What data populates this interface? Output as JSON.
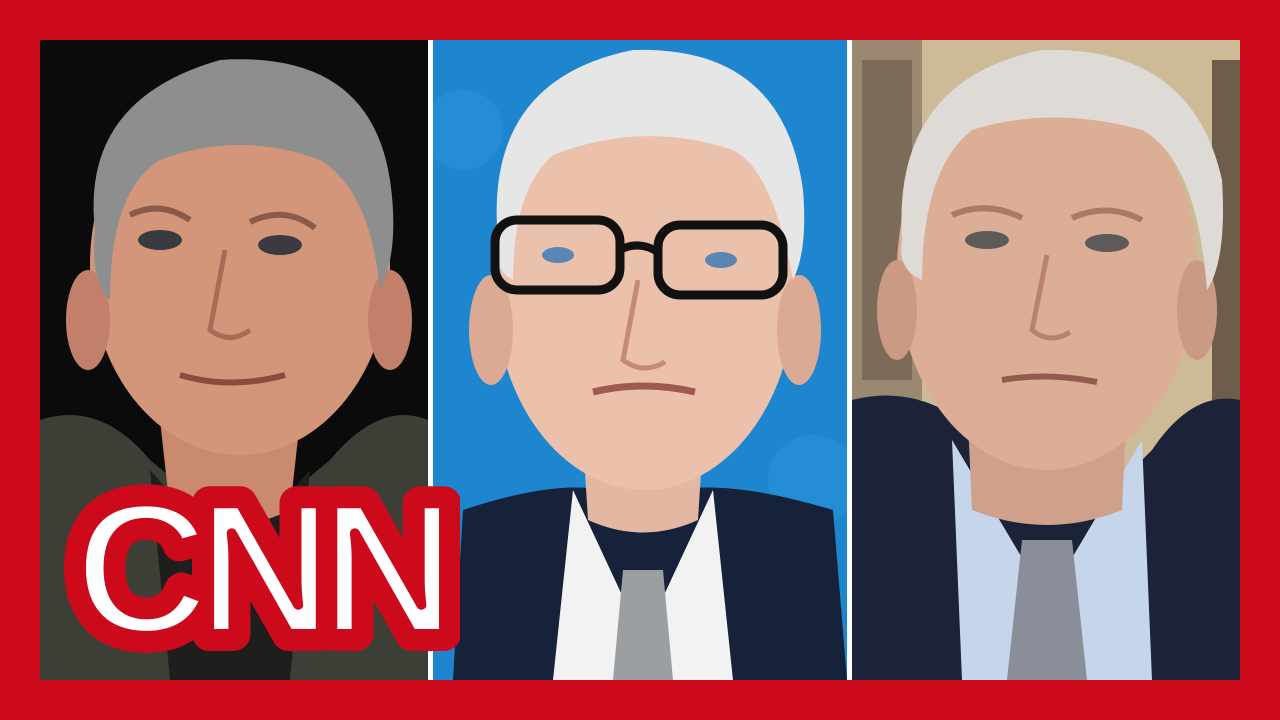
{
  "thumbnail": {
    "brand_logo_text": "CNN",
    "frame_color": "#cc0a1c",
    "panels": [
      {
        "name": "left-guest",
        "background": "#0b0b0b"
      },
      {
        "name": "center-anchor",
        "background": "#1d86cf"
      },
      {
        "name": "right-guest",
        "background": "#c9b48e"
      }
    ]
  }
}
